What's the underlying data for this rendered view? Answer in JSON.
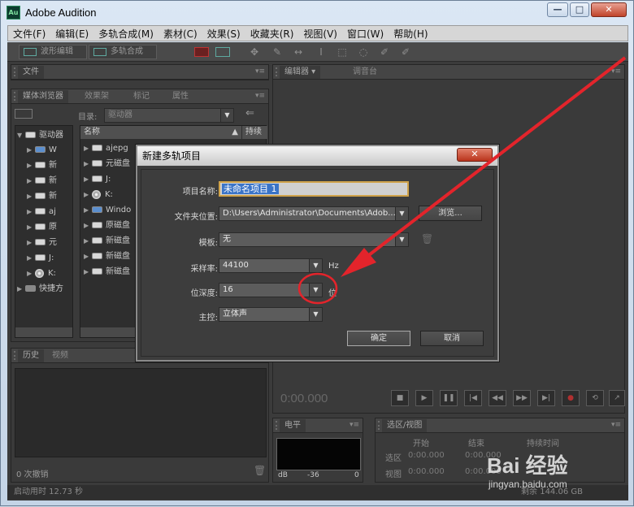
{
  "window": {
    "title": "Adobe Audition",
    "app_icon": "Au",
    "controls": [
      "—",
      "□",
      "✕"
    ]
  },
  "menu": [
    "文件(F)",
    "编辑(E)",
    "多轨合成(M)",
    "素材(C)",
    "效果(S)",
    "收藏夹(R)",
    "视图(V)",
    "窗口(W)",
    "帮助(H)"
  ],
  "toolbar": {
    "waveform_label": "波形编辑",
    "multitrack_label": "多轨合成"
  },
  "files_panel": {
    "tab": "文件"
  },
  "browser_panel": {
    "tabs": [
      "媒体浏览器",
      "效果架",
      "标记",
      "属性"
    ],
    "dir_label": "目录:",
    "dir_value": "驱动器",
    "tree_root": "驱动器",
    "tree_items": [
      "W",
      "新",
      "新",
      "新",
      "aj",
      "原",
      "元",
      "J:",
      "K:"
    ],
    "shortcuts": "快捷方",
    "list_headers": {
      "name": "名称",
      "duration": "持续"
    },
    "list_items": [
      "ajepg",
      "元磁盘",
      "J:",
      "K:",
      "Windo",
      "原磁盘",
      "新磁盘",
      "新磁盘",
      "新磁盘"
    ]
  },
  "history_panel": {
    "tabs": [
      "历史",
      "视频"
    ],
    "undo_text": "0 次撤销"
  },
  "editor_panel": {
    "tabs": [
      "编辑器",
      "调音台"
    ],
    "time": "0:00.000"
  },
  "level_panel": {
    "tab": "电平",
    "scale": [
      "dB",
      "-36",
      "0"
    ]
  },
  "selection_panel": {
    "tab": "选区/视图",
    "headers": [
      "开始",
      "结束",
      "持续时间"
    ],
    "rows": [
      {
        "label": "选区",
        "start": "0:00.000",
        "end": "0:00.000"
      },
      {
        "label": "视图",
        "start": "0:00.000",
        "end": "0:00.000"
      }
    ]
  },
  "status": {
    "left": "启动用时 12.73 秒",
    "right": "剩余 144.06 GB"
  },
  "dialog": {
    "title": "新建多轨项目",
    "close": "✕",
    "fields": {
      "project_name_label": "项目名称:",
      "project_name_value": "未命名项目 1",
      "folder_label": "文件夹位置:",
      "folder_value": "D:\\Users\\Administrator\\Documents\\Adob...",
      "browse": "浏览...",
      "template_label": "模板:",
      "template_value": "无",
      "samplerate_label": "采样率:",
      "samplerate_value": "44100",
      "samplerate_unit": "Hz",
      "bitdepth_label": "位深度:",
      "bitdepth_value": "16",
      "bitdepth_unit": "位",
      "master_label": "主控:",
      "master_value": "立体声"
    },
    "ok": "确定",
    "cancel": "取消"
  },
  "watermark": {
    "logo": "Bai 经验",
    "site": "jingyan.baidu.com"
  },
  "colors": {
    "annotation": "#e3242b",
    "dark_panel": "#3a3a3a",
    "highlight": "#3a74c8"
  }
}
